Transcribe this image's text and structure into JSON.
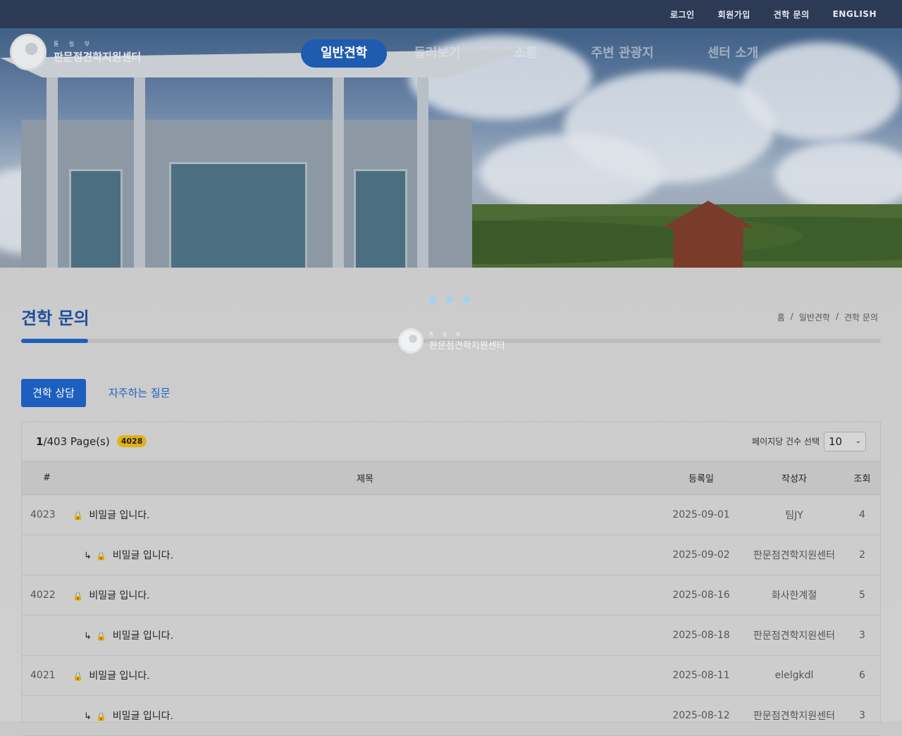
{
  "topbar": {
    "links": [
      "로그인",
      "회원가입",
      "견학 문의",
      "ENGLISH"
    ]
  },
  "logo": {
    "small": "통 일 부",
    "name": "판문점견학지원센터"
  },
  "nav": {
    "items": [
      "일반견학",
      "둘러보기",
      "소통",
      "주변 관광지",
      "센터 소개"
    ]
  },
  "page": {
    "title": "견학 문의",
    "breadcrumb": [
      "홈",
      "일반견학",
      "견학 문의"
    ]
  },
  "tabs": [
    "견학 상담",
    "자주하는 질문"
  ],
  "board": {
    "page_current": "1",
    "page_total": "/403 Page(s)",
    "total_badge": "4028",
    "perpage_label": "페이지당 건수 선택",
    "perpage_value": "10",
    "columns": [
      "#",
      "제목",
      "등록일",
      "작성자",
      "조회"
    ],
    "rows": [
      {
        "num": "4023",
        "reply": false,
        "title": "비밀글 입니다.",
        "date": "2025-09-01",
        "author": "팀JY",
        "views": "4"
      },
      {
        "num": "",
        "reply": true,
        "title": "비밀글 입니다.",
        "date": "2025-09-02",
        "author": "판문점견학지원센터",
        "views": "2"
      },
      {
        "num": "4022",
        "reply": false,
        "title": "비밀글 입니다.",
        "date": "2025-08-16",
        "author": "화사한계절",
        "views": "5"
      },
      {
        "num": "",
        "reply": true,
        "title": "비밀글 입니다.",
        "date": "2025-08-18",
        "author": "판문점견학지원센터",
        "views": "3"
      },
      {
        "num": "4021",
        "reply": false,
        "title": "비밀글 입니다.",
        "date": "2025-08-11",
        "author": "elelgkdl",
        "views": "6"
      },
      {
        "num": "",
        "reply": true,
        "title": "비밀글 입니다.",
        "date": "2025-08-12",
        "author": "판문점견학지원센터",
        "views": "3"
      }
    ]
  },
  "loader": {
    "small": "통 일 부",
    "name": "판문점견학지원센터"
  },
  "colors": {
    "accent": "#1d5fbe",
    "topbar": "#2c3a55",
    "badge": "#e0b21a"
  }
}
